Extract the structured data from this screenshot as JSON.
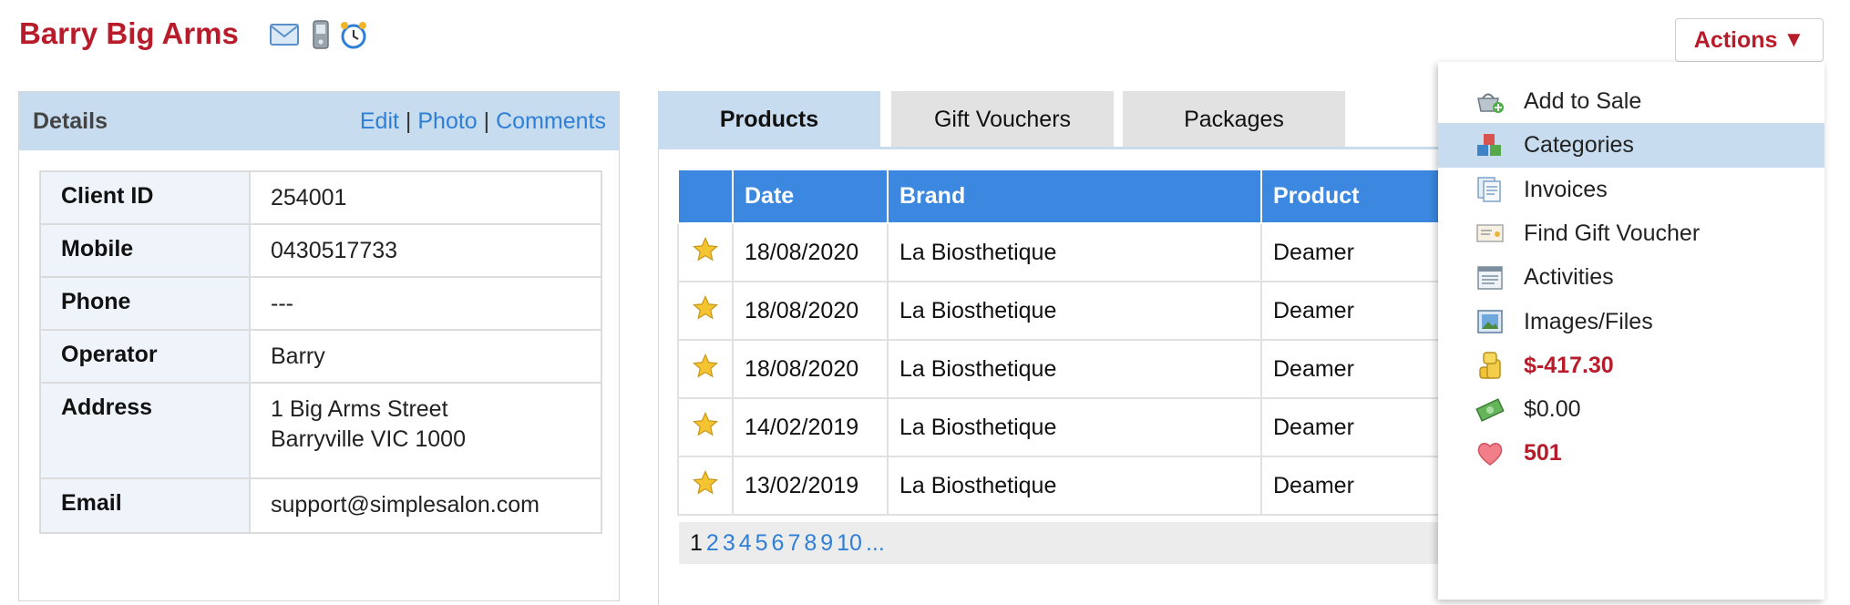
{
  "client": {
    "name": "Barry Big Arms",
    "icons": [
      "mail-icon",
      "mobile-phone-icon",
      "alarm-clock-icon"
    ]
  },
  "actions": {
    "label": "Actions"
  },
  "details": {
    "title": "Details",
    "links": {
      "edit": "Edit",
      "photo": "Photo",
      "comments": "Comments",
      "separator": "|"
    },
    "rows": [
      {
        "label": "Client ID",
        "value": [
          "254001"
        ]
      },
      {
        "label": "Mobile",
        "value": [
          "0430517733"
        ]
      },
      {
        "label": "Phone",
        "value": [
          "---"
        ]
      },
      {
        "label": "Operator",
        "value": [
          "Barry"
        ]
      },
      {
        "label": "Address",
        "value": [
          "1 Big Arms Street",
          "Barryville VIC 1000"
        ]
      },
      {
        "label": "Email",
        "value": [
          "support@simplesalon.com"
        ]
      }
    ]
  },
  "tabs": [
    {
      "label": "Products",
      "active": true
    },
    {
      "label": "Gift Vouchers",
      "active": false
    },
    {
      "label": "Packages",
      "active": false
    }
  ],
  "products": {
    "columns": [
      "",
      "Date",
      "Brand",
      "Product"
    ],
    "rows": [
      {
        "date": "18/08/2020",
        "brand": "La Biosthetique",
        "product": "Deamer"
      },
      {
        "date": "18/08/2020",
        "brand": "La Biosthetique",
        "product": "Deamer"
      },
      {
        "date": "18/08/2020",
        "brand": "La Biosthetique",
        "product": "Deamer"
      },
      {
        "date": "14/02/2019",
        "brand": "La Biosthetique",
        "product": "Deamer"
      },
      {
        "date": "13/02/2019",
        "brand": "La Biosthetique",
        "product": "Deamer"
      }
    ],
    "pager": {
      "current": "1",
      "pages": [
        "2",
        "3",
        "4",
        "5",
        "6",
        "7",
        "8",
        "9",
        "10",
        "..."
      ]
    }
  },
  "dropdown": {
    "items": [
      {
        "label": "Add to Sale",
        "icon": "basket-add-icon",
        "highlight": false,
        "red": false
      },
      {
        "label": "Categories",
        "icon": "boxes-icon",
        "highlight": true,
        "red": false
      },
      {
        "label": "Invoices",
        "icon": "documents-icon",
        "highlight": false,
        "red": false
      },
      {
        "label": "Find Gift Voucher",
        "icon": "voucher-icon",
        "highlight": false,
        "red": false
      },
      {
        "label": "Activities",
        "icon": "calendar-list-icon",
        "highlight": false,
        "red": false
      },
      {
        "label": "Images/Files",
        "icon": "image-icon",
        "highlight": false,
        "red": false
      },
      {
        "label": "$-417.30",
        "icon": "coins-icon",
        "highlight": false,
        "red": true
      },
      {
        "label": "$0.00",
        "icon": "cash-note-icon",
        "highlight": false,
        "red": false
      },
      {
        "label": "501",
        "icon": "heart-icon",
        "highlight": false,
        "red": true
      }
    ]
  },
  "colors": {
    "brand_red": "#b81c2a",
    "header_blue": "#3c87e0",
    "panel_blue": "#c7dcee",
    "link_blue": "#2f7fd6"
  }
}
